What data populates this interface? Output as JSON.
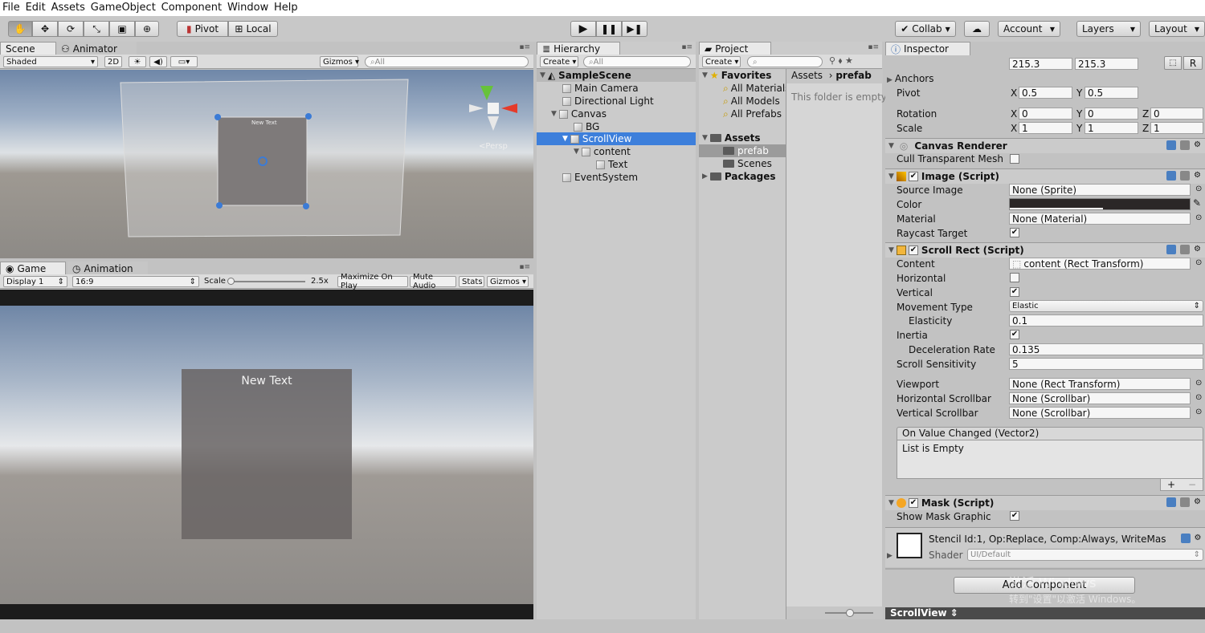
{
  "menu": [
    "File",
    "Edit",
    "Assets",
    "GameObject",
    "Component",
    "Window",
    "Help"
  ],
  "toolbar": {
    "pivot": "Pivot",
    "local": "Local",
    "collab": "Collab",
    "account": "Account",
    "layers": "Layers",
    "layout": "Layout"
  },
  "scene": {
    "tab": "Scene",
    "tab2": "Animator",
    "shading": "Shaded",
    "mode2d": "2D",
    "gizmos": "Gizmos",
    "search": "All",
    "canvas_text": "New Text",
    "persp": "Persp"
  },
  "game": {
    "tab": "Game",
    "tab2": "Animation",
    "display": "Display 1",
    "aspect": "16:9",
    "scale_label": "Scale",
    "scale_value": "2.5x",
    "scale_fraction": 0.0,
    "maximize": "Maximize On Play",
    "mute": "Mute Audio",
    "stats": "Stats",
    "gizmos": "Gizmos",
    "canvas_text": "New Text"
  },
  "hierarchy": {
    "tab": "Hierarchy",
    "create": "Create",
    "search": "All",
    "scene": "SampleScene",
    "items": [
      "Main Camera",
      "Directional Light",
      "Canvas",
      "BG",
      "ScrollView",
      "content",
      "Text",
      "EventSystem"
    ]
  },
  "project": {
    "tab": "Project",
    "create": "Create",
    "favorites": "Favorites",
    "fav_items": [
      "All Materials",
      "All Models",
      "All Prefabs"
    ],
    "assets": "Assets",
    "folders": [
      "prefab",
      "Scenes"
    ],
    "packages": "Packages",
    "breadcrumb_root": "Assets",
    "breadcrumb_leaf": "prefab",
    "empty": "This folder is empty"
  },
  "inspector": {
    "tab": "Inspector",
    "size_w": "215.3",
    "size_h": "215.3",
    "anchors": "Anchors",
    "pivot_label": "Pivot",
    "pivot_x": "0.5",
    "pivot_y": "0.5",
    "rotation_label": "Rotation",
    "rotation": [
      "0",
      "0",
      "0"
    ],
    "scale_label": "Scale",
    "scale": [
      "1",
      "1",
      "1"
    ],
    "axis": [
      "X",
      "Y",
      "Z"
    ],
    "r_button": "R",
    "canvas_renderer": "Canvas Renderer",
    "cull": "Cull Transparent Mesh",
    "image_script": "Image (Script)",
    "source_image_label": "Source Image",
    "source_image": "None (Sprite)",
    "color_label": "Color",
    "material_label": "Material",
    "material": "None (Material)",
    "raycast_label": "Raycast Target",
    "scroll_rect": "Scroll Rect (Script)",
    "content_label": "Content",
    "content": "content (Rect Transform)",
    "horizontal_label": "Horizontal",
    "vertical_label": "Vertical",
    "movement_label": "Movement Type",
    "movement": "Elastic",
    "elasticity_label": "Elasticity",
    "elasticity": "0.1",
    "inertia_label": "Inertia",
    "decel_label": "Deceleration Rate",
    "decel": "0.135",
    "sensitivity_label": "Scroll Sensitivity",
    "sensitivity": "5",
    "viewport_label": "Viewport",
    "viewport": "None (Rect Transform)",
    "hscroll_label": "Horizontal Scrollbar",
    "hscroll": "None (Scrollbar)",
    "vscroll_label": "Vertical Scrollbar",
    "vscroll": "None (Scrollbar)",
    "event_header": "On Value Changed (Vector2)",
    "event_empty": "List is Empty",
    "plus": "+",
    "minus": "−",
    "mask_script": "Mask (Script)",
    "show_mask_label": "Show Mask Graphic",
    "material_preview": "Stencil Id:1, Op:Replace, Comp:Always, WriteMas",
    "shader_label": "Shader",
    "shader": "UI/Default",
    "add_component": "Add Component",
    "footer": "ScrollView",
    "watermark1": "激活 Windows",
    "watermark2": "转到\"设置\"以激活 Windows。"
  },
  "colors": {
    "selection": "#3d7fdb",
    "panel": "#c2c2c2",
    "game_bg": "#7f7f7f"
  }
}
